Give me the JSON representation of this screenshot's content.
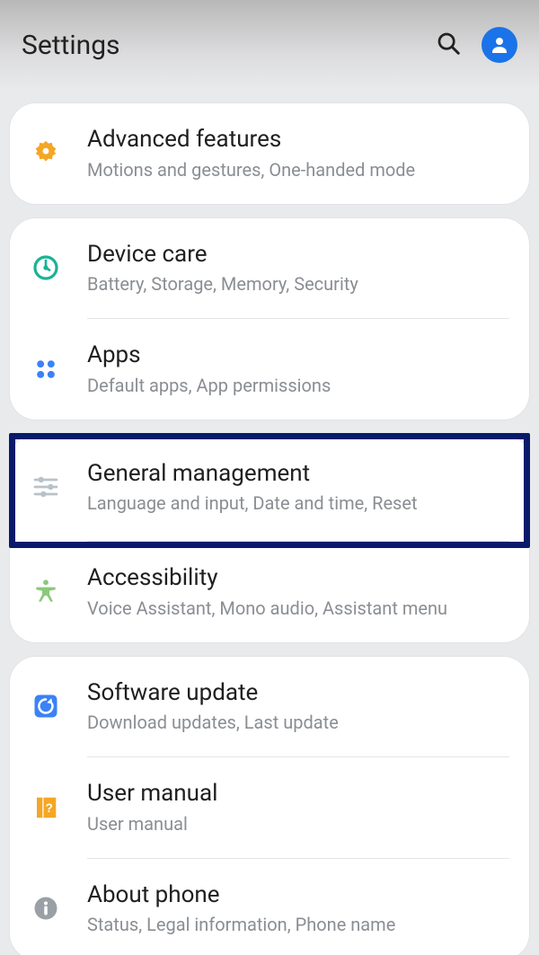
{
  "header": {
    "title": "Settings"
  },
  "groups": {
    "advanced": {
      "title": "Advanced features",
      "sub": "Motions and gestures, One-handed mode"
    },
    "device_care": {
      "title": "Device care",
      "sub": "Battery, Storage, Memory, Security"
    },
    "apps": {
      "title": "Apps",
      "sub": "Default apps, App permissions"
    },
    "general_mgmt": {
      "title": "General management",
      "sub": "Language and input, Date and time, Reset"
    },
    "accessibility": {
      "title": "Accessibility",
      "sub": "Voice Assistant, Mono audio, Assistant menu"
    },
    "software_update": {
      "title": "Software update",
      "sub": "Download updates, Last update"
    },
    "user_manual": {
      "title": "User manual",
      "sub": "User manual"
    },
    "about_phone": {
      "title": "About phone",
      "sub": "Status, Legal information, Phone name"
    }
  }
}
